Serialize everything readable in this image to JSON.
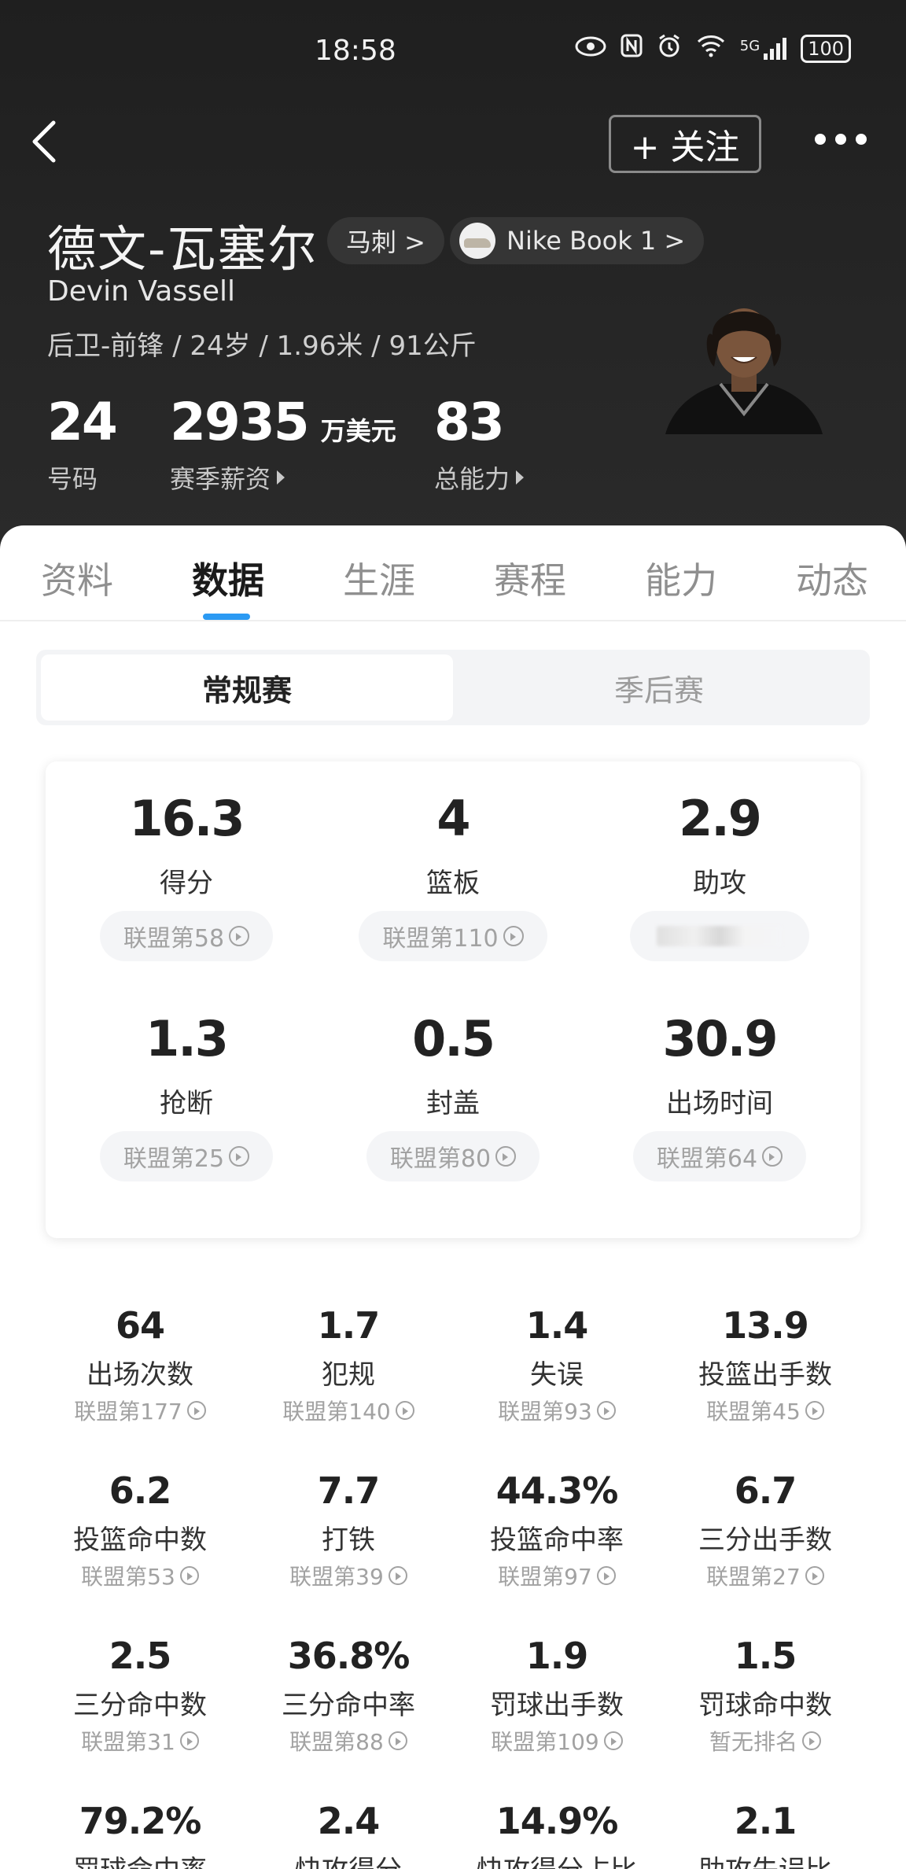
{
  "status_bar": {
    "time": "18:58",
    "network": "5G",
    "battery": "100"
  },
  "header": {
    "follow_label": "+ 关注",
    "name_cn": "德文-瓦塞尔",
    "team_chip": "马刺 >",
    "shoe_chip": "Nike Book 1 >",
    "name_en": "Devin Vassell",
    "meta": "后卫-前锋 / 24岁 / 1.96米 / 91公斤",
    "jersey_value": "24",
    "jersey_label": "号码",
    "salary_value": "2935",
    "salary_unit": "万美元",
    "salary_label": "赛季薪资",
    "rating_value": "83",
    "rating_label": "总能力"
  },
  "tabs": [
    "资料",
    "数据",
    "生涯",
    "赛程",
    "能力",
    "动态"
  ],
  "active_tab": "数据",
  "segment": {
    "regular": "常规赛",
    "playoffs": "季后赛"
  },
  "main_stats": [
    {
      "value": "16.3",
      "label": "得分",
      "rank": "联盟第58"
    },
    {
      "value": "4",
      "label": "篮板",
      "rank": "联盟第110"
    },
    {
      "value": "2.9",
      "label": "助攻",
      "rank": ""
    },
    {
      "value": "1.3",
      "label": "抢断",
      "rank": "联盟第25"
    },
    {
      "value": "0.5",
      "label": "封盖",
      "rank": "联盟第80"
    },
    {
      "value": "30.9",
      "label": "出场时间",
      "rank": "联盟第64"
    }
  ],
  "detail_stats": [
    {
      "value": "64",
      "label": "出场次数",
      "rank": "联盟第177"
    },
    {
      "value": "1.7",
      "label": "犯规",
      "rank": "联盟第140"
    },
    {
      "value": "1.4",
      "label": "失误",
      "rank": "联盟第93"
    },
    {
      "value": "13.9",
      "label": "投篮出手数",
      "rank": "联盟第45"
    },
    {
      "value": "6.2",
      "label": "投篮命中数",
      "rank": "联盟第53"
    },
    {
      "value": "7.7",
      "label": "打铁",
      "rank": "联盟第39"
    },
    {
      "value": "44.3%",
      "label": "投篮命中率",
      "rank": "联盟第97"
    },
    {
      "value": "6.7",
      "label": "三分出手数",
      "rank": "联盟第27"
    },
    {
      "value": "2.5",
      "label": "三分命中数",
      "rank": "联盟第31"
    },
    {
      "value": "36.8%",
      "label": "三分命中率",
      "rank": "联盟第88"
    },
    {
      "value": "1.9",
      "label": "罚球出手数",
      "rank": "联盟第109"
    },
    {
      "value": "1.5",
      "label": "罚球命中数",
      "rank": "暂无排名"
    },
    {
      "value": "79.2%",
      "label": "罚球命中率",
      "rank": ""
    },
    {
      "value": "2.4",
      "label": "快攻得分",
      "rank": ""
    },
    {
      "value": "14.9%",
      "label": "快攻得分占比",
      "rank": ""
    },
    {
      "value": "2.1",
      "label": "助攻失误比",
      "rank": ""
    }
  ],
  "colors": {
    "header_bg": "#222222",
    "accent": "#2b9af3"
  }
}
